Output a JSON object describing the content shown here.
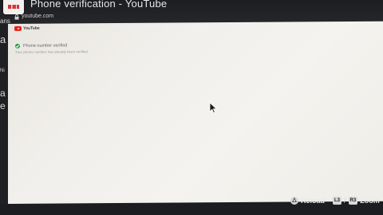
{
  "window": {
    "title": "Phone verification - YouTube",
    "url": "youtube.com",
    "icon": "youtube-app-icon"
  },
  "left_fragments": [
    "ans",
    "a",
    "Ni",
    "a",
    "e"
  ],
  "page": {
    "logo_text": "YouTube",
    "verification": {
      "title": "Phone number verified",
      "description": "Your phone number has already been verified"
    }
  },
  "bottom_hints": {
    "reload_button": "△",
    "reload_label": "Reload",
    "zoom_left_button": "L3",
    "zoom_right_button": "R3",
    "zoom_separator": "/",
    "zoom_label": "Zoom"
  },
  "colors": {
    "accent": "#e2231a",
    "success": "#2e9e46",
    "page_background": "#f1efeb",
    "system_bar": "#1f2023"
  }
}
